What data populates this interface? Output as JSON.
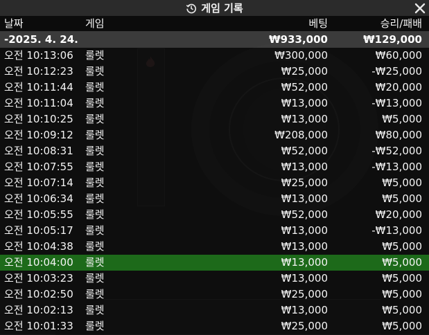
{
  "header": {
    "title": "게임 기록",
    "icon": "history-clock-icon",
    "close_icon": "close-icon"
  },
  "columns": {
    "date": "날짜",
    "game": "게임",
    "bet": "베팅",
    "result": "승리/패배"
  },
  "summary": {
    "date": "-2025. 4. 24.",
    "bet": "₩933,000",
    "result": "₩129,000"
  },
  "rows": [
    {
      "time": "오전 10:13:06",
      "game": "룰렛",
      "bet": "₩300,000",
      "result": "₩60,000",
      "highlight": false
    },
    {
      "time": "오전 10:12:23",
      "game": "룰렛",
      "bet": "₩25,000",
      "result": "-₩25,000",
      "highlight": false
    },
    {
      "time": "오전 10:11:44",
      "game": "룰렛",
      "bet": "₩52,000",
      "result": "₩20,000",
      "highlight": false
    },
    {
      "time": "오전 10:11:04",
      "game": "룰렛",
      "bet": "₩13,000",
      "result": "-₩13,000",
      "highlight": false
    },
    {
      "time": "오전 10:10:25",
      "game": "룰렛",
      "bet": "₩13,000",
      "result": "₩5,000",
      "highlight": false
    },
    {
      "time": "오전 10:09:12",
      "game": "룰렛",
      "bet": "₩208,000",
      "result": "₩80,000",
      "highlight": false
    },
    {
      "time": "오전 10:08:31",
      "game": "룰렛",
      "bet": "₩52,000",
      "result": "-₩52,000",
      "highlight": false
    },
    {
      "time": "오전 10:07:55",
      "game": "룰렛",
      "bet": "₩13,000",
      "result": "-₩13,000",
      "highlight": false
    },
    {
      "time": "오전 10:07:14",
      "game": "룰렛",
      "bet": "₩25,000",
      "result": "₩5,000",
      "highlight": false
    },
    {
      "time": "오전 10:06:34",
      "game": "룰렛",
      "bet": "₩13,000",
      "result": "₩5,000",
      "highlight": false
    },
    {
      "time": "오전 10:05:55",
      "game": "룰렛",
      "bet": "₩52,000",
      "result": "₩20,000",
      "highlight": false
    },
    {
      "time": "오전 10:05:17",
      "game": "룰렛",
      "bet": "₩13,000",
      "result": "-₩13,000",
      "highlight": false
    },
    {
      "time": "오전 10:04:38",
      "game": "룰렛",
      "bet": "₩13,000",
      "result": "₩5,000",
      "highlight": false
    },
    {
      "time": "오전 10:04:00",
      "game": "룰렛",
      "bet": "₩13,000",
      "result": "₩5,000",
      "highlight": true
    },
    {
      "time": "오전 10:03:23",
      "game": "룰렛",
      "bet": "₩13,000",
      "result": "₩5,000",
      "highlight": false
    },
    {
      "time": "오전 10:02:50",
      "game": "룰렛",
      "bet": "₩25,000",
      "result": "₩5,000",
      "highlight": false
    },
    {
      "time": "오전 10:02:13",
      "game": "룰렛",
      "bet": "₩13,000",
      "result": "₩5,000",
      "highlight": false
    },
    {
      "time": "오전 10:01:33",
      "game": "룰렛",
      "bet": "₩25,000",
      "result": "₩5,000",
      "highlight": false
    }
  ],
  "colors": {
    "highlight_row": "#1d6a1a",
    "header_bar": "#2b2b2b"
  }
}
